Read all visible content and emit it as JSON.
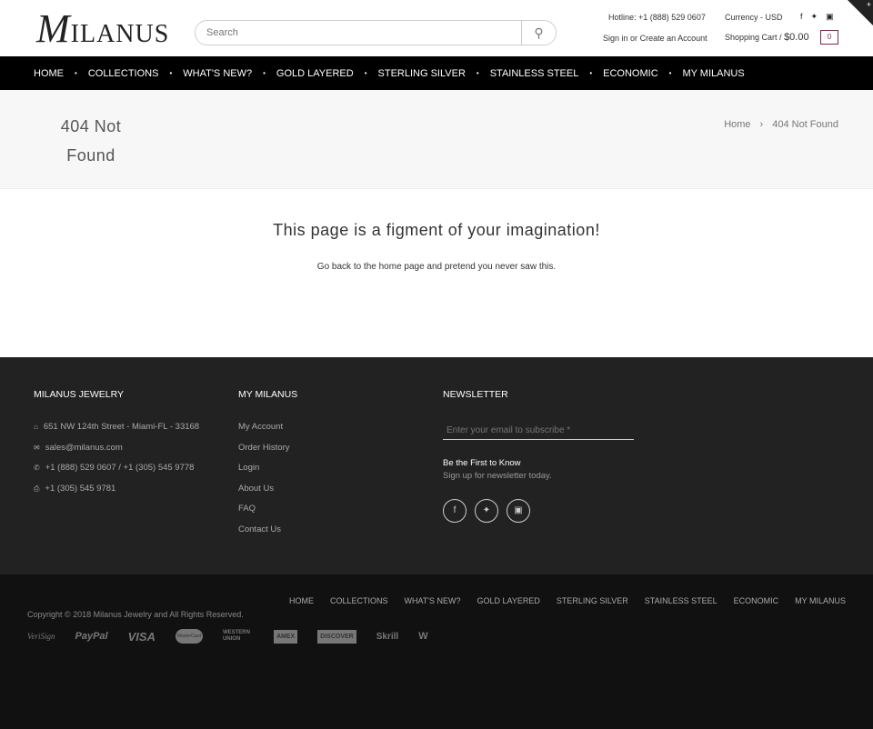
{
  "header": {
    "logo": "MILANUS",
    "search_placeholder": "Search",
    "hotline": "Hotline: +1 (888) 529 0607",
    "currency": "Currency - USD",
    "sign_in": "Sign in",
    "or": "or",
    "create_account": "Create an Account",
    "cart_label": "Shopping Cart /",
    "cart_total": "$0.00",
    "cart_count": "0",
    "social": [
      "facebook-icon",
      "twitter-icon",
      "instagram-icon"
    ]
  },
  "nav": [
    "HOME",
    "COLLECTIONS",
    "WHAT'S NEW?",
    "GOLD LAYERED",
    "STERLING SILVER",
    "STAINLESS STEEL",
    "ECONOMIC",
    "MY MILANUS"
  ],
  "title_bar": {
    "title": "404 Not Found",
    "breadcrumb": [
      "Home",
      "404 Not Found"
    ]
  },
  "main": {
    "heading": "This page is a figment of your imagination!",
    "text": "Go back to the home page and pretend you never saw this."
  },
  "footer": {
    "col1": {
      "title": "MILANUS JEWELRY",
      "items": [
        "651 NW 124th Street - Miami-FL - 33168",
        "sales@milanus.com",
        "+1 (888) 529 0607 / +1 (305) 545 9778",
        "+1 (305) 545 9781"
      ]
    },
    "col2": {
      "title": "MY MILANUS",
      "items": [
        "My Account",
        "Order History",
        "Login",
        "About Us",
        "FAQ",
        "Contact Us"
      ]
    },
    "col3": {
      "title": "NEWSLETTER",
      "placeholder": "Enter your email to subscribe *",
      "strong": "Be the First to Know",
      "sub": "Sign up for newsletter today."
    }
  },
  "bottom": {
    "nav": [
      "HOME",
      "COLLECTIONS",
      "WHAT'S NEW?",
      "GOLD LAYERED",
      "STERLING SILVER",
      "STAINLESS STEEL",
      "ECONOMIC",
      "MY MILANUS"
    ],
    "copyright": "Copyright © 2018 Milanus Jewelry and All Rights Reserved.",
    "payments": [
      "VeriSign",
      "PayPal",
      "VISA",
      "MasterCard",
      "WESTERN UNION",
      "AMEX",
      "DISCOVER",
      "Skrill",
      "W"
    ]
  },
  "colors": {
    "nav_bg": "#000000",
    "footer_bg": "#222222",
    "bottom_bg": "#111111",
    "cart_accent": "#7a2a4a"
  }
}
